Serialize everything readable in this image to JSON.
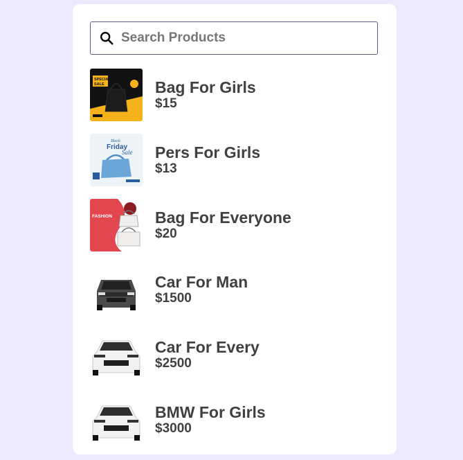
{
  "search": {
    "placeholder": "Search Products",
    "value": ""
  },
  "products": [
    {
      "name": "Bag For Girls",
      "price": "$15",
      "image_icon": "black-handbag-special-sale-icon",
      "image_text": [
        "SPECIAL",
        "SALE"
      ]
    },
    {
      "name": "Pers For Girls",
      "price": "$13",
      "image_icon": "blue-handbag-black-friday-icon",
      "image_text": [
        "Black",
        "Friday",
        "Sale"
      ]
    },
    {
      "name": "Bag For Everyone",
      "price": "$20",
      "image_icon": "white-handbags-fashion-icon",
      "image_text": [
        "FASHION"
      ]
    },
    {
      "name": "Car For Man",
      "price": "$1500",
      "image_icon": "dark-grey-suv-icon",
      "image_text": []
    },
    {
      "name": "Car For Every",
      "price": "$2500",
      "image_icon": "white-sedan-icon",
      "image_text": []
    },
    {
      "name": "BMW For Girls",
      "price": "$3000",
      "image_icon": "white-sedan-icon",
      "image_text": []
    }
  ],
  "colors": {
    "page_background": "#ece8fd",
    "card_background": "#ffffff",
    "text": "#404040",
    "search_border": "#5b5b8a"
  }
}
